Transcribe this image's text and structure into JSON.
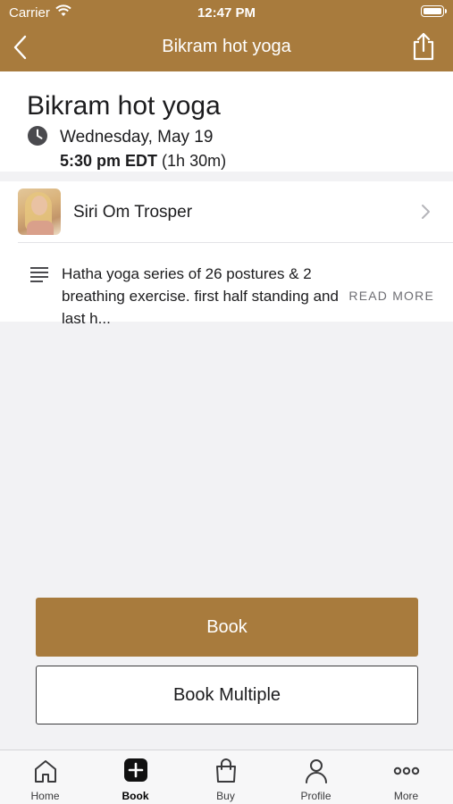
{
  "status_bar": {
    "carrier": "Carrier",
    "time": "12:47 PM"
  },
  "nav": {
    "title": "Bikram hot yoga",
    "back_icon": "chevron-left-icon",
    "share_icon": "share-icon"
  },
  "class_info": {
    "title": "Bikram hot yoga",
    "date": "Wednesday, May 19",
    "start_time": "5:30 pm EDT",
    "duration": "(1h 30m)"
  },
  "instructor": {
    "name": "Siri Om Trosper"
  },
  "description": {
    "text": "Hatha yoga series of 26 postures & 2 breathing exercise. first half standing and last h...",
    "read_more": "READ MORE"
  },
  "actions": {
    "book_label": "Book",
    "book_multiple_label": "Book Multiple"
  },
  "tab_bar": {
    "items": [
      {
        "label": "Home",
        "icon": "home-icon",
        "active": false
      },
      {
        "label": "Book",
        "icon": "plus-square-icon",
        "active": true
      },
      {
        "label": "Buy",
        "icon": "shopping-bag-icon",
        "active": false
      },
      {
        "label": "Profile",
        "icon": "person-icon",
        "active": false
      },
      {
        "label": "More",
        "icon": "more-dots-icon",
        "active": false
      }
    ]
  },
  "colors": {
    "brand": "#a87b3d",
    "background": "#f2f2f4",
    "card": "#ffffff"
  }
}
